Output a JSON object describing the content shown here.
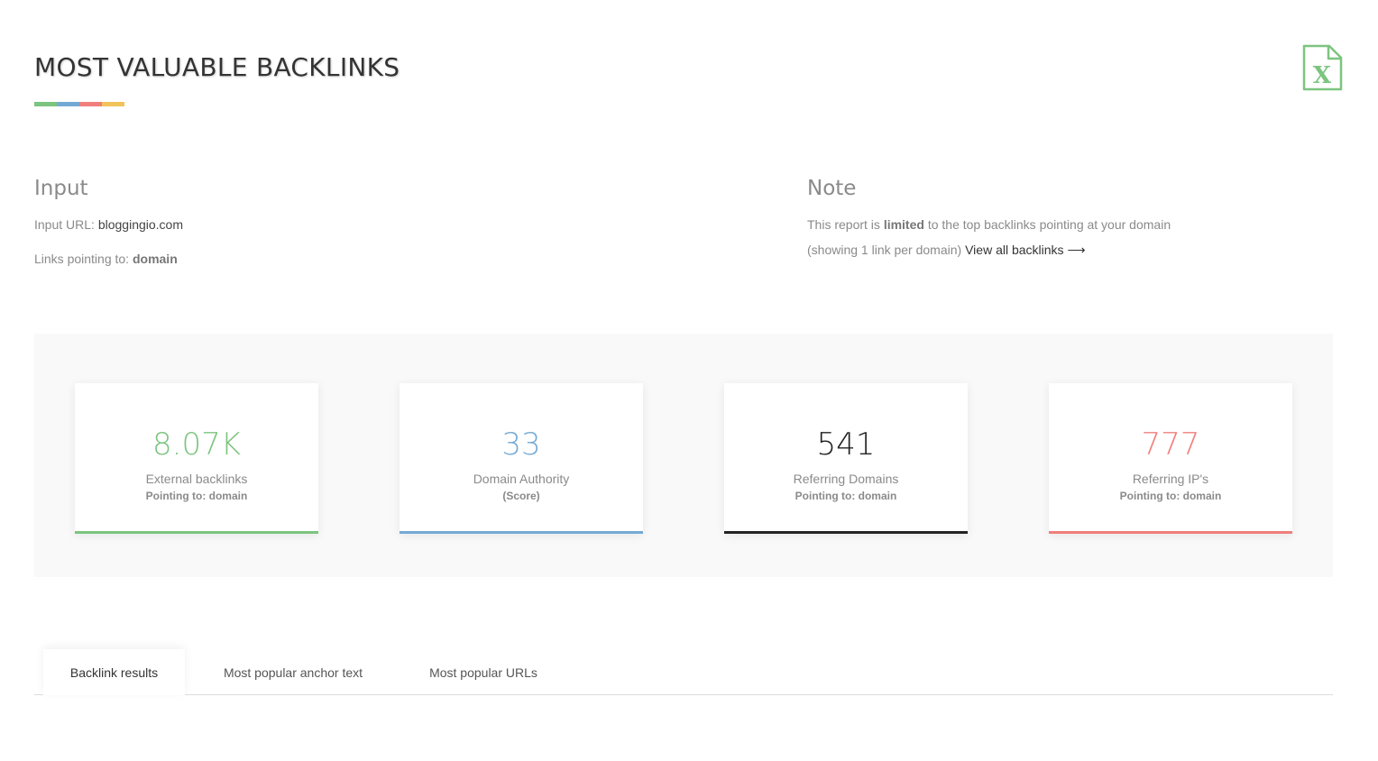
{
  "header": {
    "title": "MOST VALUABLE BACKLINKS",
    "underline_colors": [
      "#7cc47f",
      "#74a9d4",
      "#f07f7c",
      "#f0c45a"
    ],
    "export_icon": "excel-icon",
    "export_icon_color": "#7cc47f",
    "export_icon_letter": "X"
  },
  "input": {
    "heading": "Input",
    "url_label": "Input URL:",
    "url_value": "bloggingio.com",
    "links_label": "Links pointing to:",
    "links_value": "domain"
  },
  "note": {
    "heading": "Note",
    "line1_before": "This report is",
    "line1_bold": "limited",
    "line1_after": "to the top backlinks pointing at your domain",
    "line2_text": "(showing 1 link per domain)",
    "view_all_label": "View all backlinks",
    "view_all_arrow": "⟶"
  },
  "stats": [
    {
      "value": "8.07K",
      "label": "External backlinks",
      "sub": "Pointing to: domain",
      "color": "#7cc47f"
    },
    {
      "value": "33",
      "label": "Domain Authority",
      "sub": "(Score)",
      "color": "#74a9d4"
    },
    {
      "value": "541",
      "label": "Referring Domains",
      "sub": "Pointing to: domain",
      "color": "#222222"
    },
    {
      "value": "777",
      "label": "Referring IP's",
      "sub": "Pointing to: domain",
      "color": "#f07f7c"
    }
  ],
  "tabs": [
    {
      "label": "Backlink results",
      "active": true
    },
    {
      "label": "Most popular anchor text",
      "active": false
    },
    {
      "label": "Most popular URLs",
      "active": false
    }
  ]
}
